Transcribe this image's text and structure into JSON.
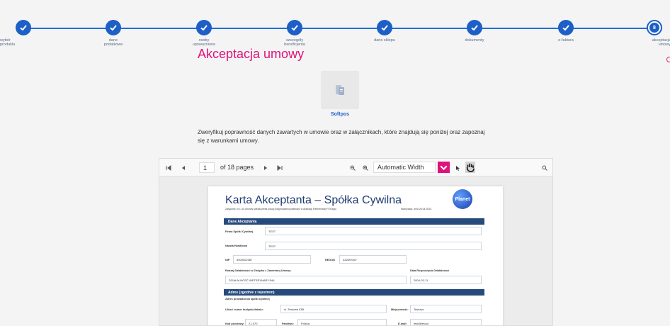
{
  "stepper": {
    "steps": [
      {
        "label_1": "wybór",
        "label_2": "produktu"
      },
      {
        "label_1": "dane",
        "label_2": "podatkowe"
      },
      {
        "label_1": "osoby",
        "label_2": "upoważnione"
      },
      {
        "label_1": "szczegóły",
        "label_2": "beneficjenta"
      },
      {
        "label_1": "dane sklepu",
        "label_2": ""
      },
      {
        "label_1": "dokumenty",
        "label_2": ""
      },
      {
        "label_1": "e-faktura",
        "label_2": ""
      },
      {
        "label_1": "akceptacja",
        "label_2": "umowy",
        "number": "8"
      }
    ],
    "accent": "#1d5fc7"
  },
  "page_title": "Akceptacja umowy",
  "product": {
    "name": "Softpos"
  },
  "info_text": "Zweryfikuj poprawność danych zawartych w umowie oraz w załącznikach, które znajdują się poniżej oraz zapoznaj się z warunkami umowy.",
  "viewer": {
    "page_number": "1",
    "of_pages": "of 18 pages",
    "zoom": "Automatic Width",
    "accent": "#e0117a"
  },
  "document": {
    "title": "Karta Akceptanta – Spółka Cywilna",
    "subtitle": "Załącznik nr 1 do Umowy świadczenia usług przyjmowania płatności w Aplikacji Partnerskiej POSapp.",
    "date": "Warszawa, dnia 26.04.2024",
    "logo_text": "Planet",
    "section_1": "Dane Akceptanta",
    "firma_label": "Firma Spółki Cywilnej",
    "firma_value": "TEST",
    "nazwa_label": "Nazwa Handlowa",
    "nazwa_value": "TEST",
    "nip_label": "NIP",
    "nip_value": "5000002387",
    "regon_label": "REGON",
    "regon_value": "432897807",
    "rodzaj_label": "Rodzaj Działalności w Związku z Zawieraną Umową",
    "rodzaj_value": "DZIAŁALNOŚĆ WETERYNARYJNA",
    "data_label": "Data Rozpoczęcia Działalności",
    "data_value": "2004-03-11",
    "section_2": "Adres (zgodnie z rejestrem)",
    "adres_label": "Adres prowadzenia spółki cywilnej",
    "ulica_label": "Ulica i numer budynku/lokalu:",
    "ulica_value": "ul. Testowa 93B",
    "miejscowosc_label": "Miejscowość:",
    "miejscowosc_value": "Testowo",
    "kod_label": "Kod pocztowy:",
    "kod_value": "21-070",
    "panstwo_label": "Państwo:",
    "panstwo_value": "Polska",
    "email_label": "E-mail:",
    "email_value": "test@test.pl"
  }
}
